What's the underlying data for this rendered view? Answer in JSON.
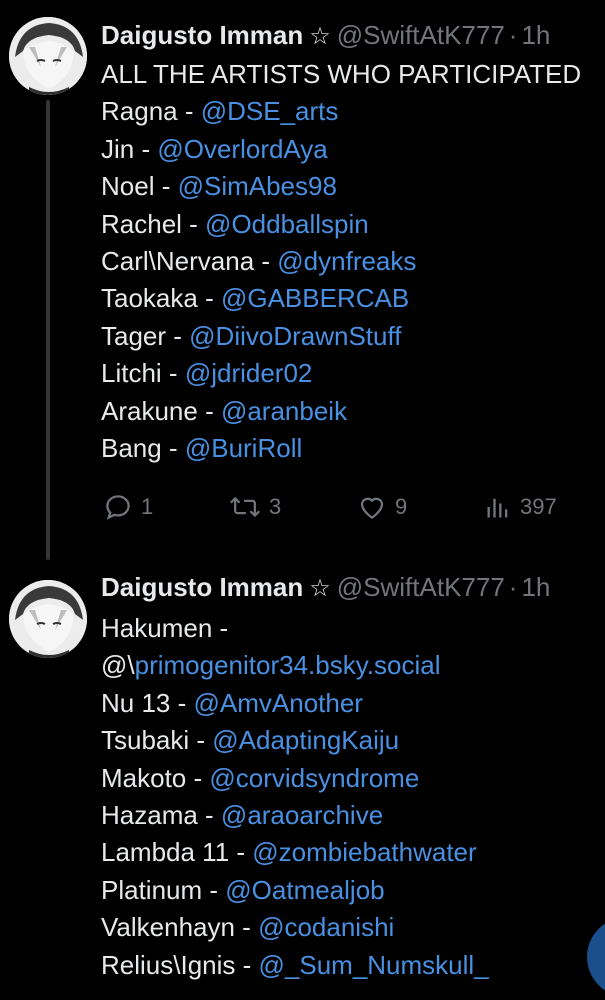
{
  "tweets": [
    {
      "author": {
        "display_name": "Daigusto Imman",
        "badge": "☆",
        "handle": "@SwiftAtK777",
        "separator": "·",
        "time": "1h"
      },
      "lines": [
        {
          "prefix": "ALL THE ARTISTS WHO PARTICIPATED",
          "mention": ""
        },
        {
          "prefix": "Ragna - ",
          "mention": "@DSE_arts"
        },
        {
          "prefix": "Jin - ",
          "mention": "@OverlordAya"
        },
        {
          "prefix": "Noel - ",
          "mention": "@SimAbes98"
        },
        {
          "prefix": "Rachel - ",
          "mention": "@Oddballspin"
        },
        {
          "prefix": "Carl\\Nervana - ",
          "mention": "@dynfreaks"
        },
        {
          "prefix": "Taokaka - ",
          "mention": "@GABBERCAB"
        },
        {
          "prefix": "Tager - ",
          "mention": "@DiivoDrawnStuff"
        },
        {
          "prefix": "Litchi - ",
          "mention": "@jdrider02"
        },
        {
          "prefix": "Arakune - ",
          "mention": "@aranbeik"
        },
        {
          "prefix": "Bang - ",
          "mention": "@BuriRoll"
        }
      ],
      "actions": {
        "replies": "1",
        "reposts": "3",
        "likes": "9",
        "views": "397"
      }
    },
    {
      "author": {
        "display_name": "Daigusto Imman",
        "badge": "☆",
        "handle": "@SwiftAtK777",
        "separator": "·",
        "time": "1h"
      },
      "lines": [
        {
          "prefix": "Hakumen -",
          "mention": ""
        },
        {
          "prefix": "@\\",
          "mention": "primogenitor34.bsky.social"
        },
        {
          "prefix": "Nu 13 - ",
          "mention": "@AmvAnother"
        },
        {
          "prefix": "Tsubaki - ",
          "mention": "@AdaptingKaiju"
        },
        {
          "prefix": "Makoto - ",
          "mention": "@corvidsyndrome"
        },
        {
          "prefix": "Hazama - ",
          "mention": "@araoarchive"
        },
        {
          "prefix": "Lambda 11 - ",
          "mention": "@zombiebathwater"
        },
        {
          "prefix": "Platinum - ",
          "mention": "@Oatmealjob"
        },
        {
          "prefix": "Valkenhayn - ",
          "mention": "@codanishi"
        },
        {
          "prefix": "Relius\\Ignis - ",
          "mention": "@_Sum_Numskull_"
        }
      ]
    }
  ],
  "icons": {
    "reply": "reply-icon",
    "repost": "repost-icon",
    "like": "heart-icon",
    "views": "views-icon"
  },
  "colors": {
    "background": "#000000",
    "text": "#e7e9ea",
    "muted": "#71767b",
    "mention": "#4a90e2",
    "thread_line": "#333639"
  }
}
